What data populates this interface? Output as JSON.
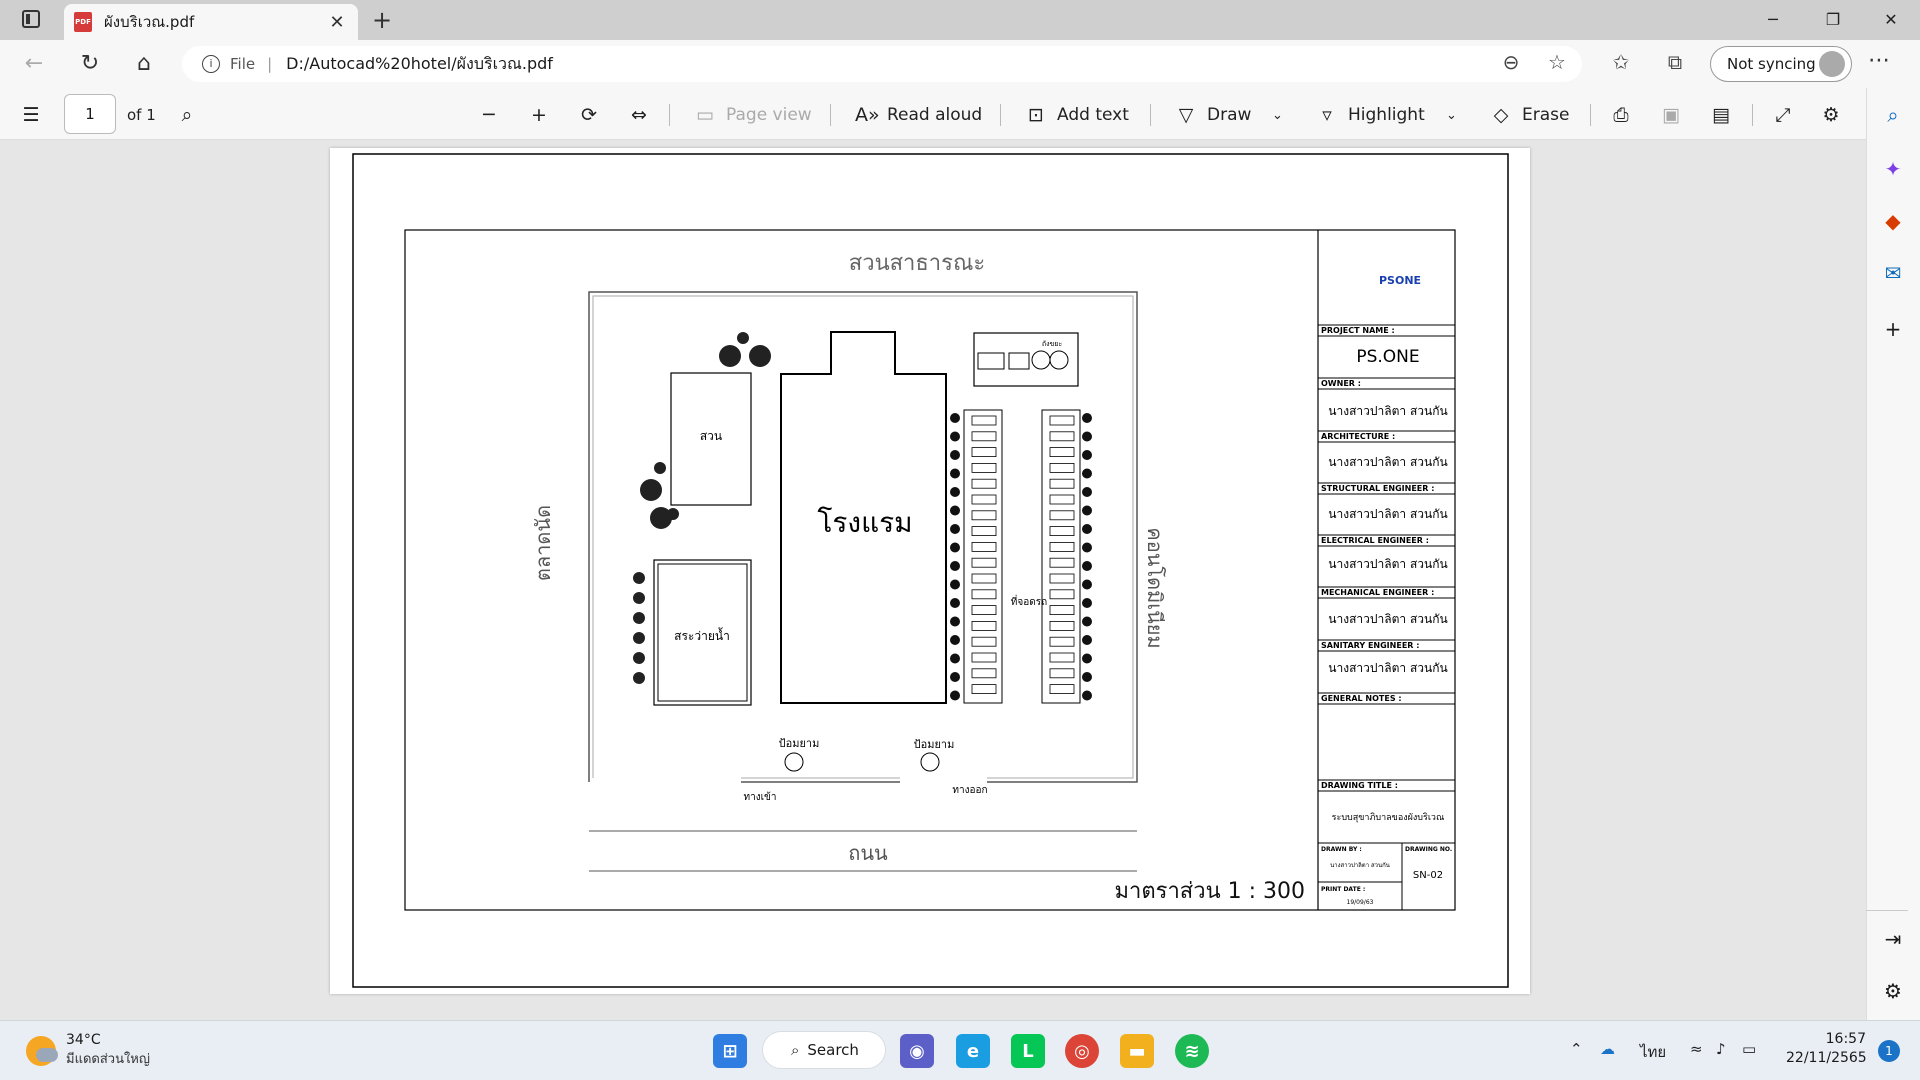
{
  "tab": {
    "title": "ผังบริเวณ.pdf",
    "pdf_badge": "PDF"
  },
  "address": {
    "file_label": "File",
    "url": "D:/Autocad%20hotel/ผังบริเวณ.pdf"
  },
  "profile": {
    "sync_label": "Not syncing"
  },
  "pdf_toolbar": {
    "page_current": "1",
    "page_total": "of 1",
    "page_view": "Page view",
    "read_aloud": "Read aloud",
    "add_text": "Add text",
    "draw": "Draw",
    "highlight": "Highlight",
    "erase": "Erase"
  },
  "drawing": {
    "top_label": "สวนสาธารณะ",
    "road_label": "ถนน",
    "left_label": "ตลาดนัด",
    "right_label": "คอนโดมิเนียม",
    "hotel_label": "โรงแรม",
    "garden_label": "สวน",
    "pool_label": "สระว่ายน้ำ",
    "parking_label": "ที่จอดรถ",
    "guard1": "ป้อมยาม",
    "guard2": "ป้อมยาม",
    "entrance": "ทางเข้า",
    "exit": "ทางออก",
    "trash_label": "ถังขยะ",
    "scale": "มาตราส่วน  1 : 300"
  },
  "titleblock": {
    "logo": "PSONE",
    "project_name_label": "PROJECT NAME :",
    "project_name": "PS.ONE",
    "owner_label": "OWNER :",
    "owner": "นางสาวปาลิตา สวนกัน",
    "arch_label": "ARCHITECTURE :",
    "arch": "นางสาวปาลิตา สวนกัน",
    "struct_label": "STRUCTURAL ENGINEER :",
    "struct": "นางสาวปาลิตา สวนกัน",
    "elec_label": "ELECTRICAL ENGINEER :",
    "elec": "นางสาวปาลิตา สวนกัน",
    "mech_label": "MECHANICAL ENGINEER :",
    "mech": "นางสาวปาลิตา สวนกัน",
    "san_label": "SANITARY ENGINEER :",
    "san": "นางสาวปาลิตา สวนกัน",
    "notes_label": "GENERAL NOTES :",
    "title_label": "DRAWING TITLE :",
    "title": "ระบบสุขาภิบาลของผังบริเวณ",
    "drawn_label": "DRAWN BY :",
    "drawn": "นางสาวปาลิตา สวนกัน",
    "no_label": "DRAWING NO.",
    "no": "SN-02",
    "print_label": "PRINT DATE :",
    "print": "19/09/63"
  },
  "taskbar": {
    "temp": "34°C",
    "weather": "มีแดดส่วนใหญ่",
    "search": "Search",
    "lang": "ไทย",
    "time": "16:57",
    "date": "22/11/2565",
    "notif": "1"
  },
  "colors": {
    "accent": "#0f6cbd",
    "pdf_red": "#d63b3b"
  }
}
